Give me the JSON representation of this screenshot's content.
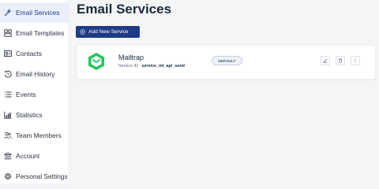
{
  "sidebar": {
    "items": [
      {
        "label": "Email Services",
        "icon": "wand-icon",
        "active": true
      },
      {
        "label": "Email Templates",
        "icon": "template-icon"
      },
      {
        "label": "Contacts",
        "icon": "contact-card-icon"
      },
      {
        "label": "Email History",
        "icon": "history-icon"
      },
      {
        "label": "Events",
        "icon": "list-icon"
      },
      {
        "label": "Statistics",
        "icon": "chart-icon"
      },
      {
        "label": "Team Members",
        "icon": "team-icon"
      },
      {
        "label": "Account",
        "icon": "bank-icon"
      },
      {
        "label": "Personal Settings",
        "icon": "gear-icon"
      }
    ]
  },
  "main": {
    "title": "Email Services",
    "add_button_label": "Add New Service",
    "services": [
      {
        "name": "Mailtrap",
        "service_id_label": "Service ID:",
        "service_id": "service_mt_api_send",
        "badge": "DEFAULT",
        "logo_color": "#22c55e"
      }
    ]
  },
  "colors": {
    "accent": "#1f3b86",
    "sidebar_active_bg": "#eaf0fb"
  }
}
